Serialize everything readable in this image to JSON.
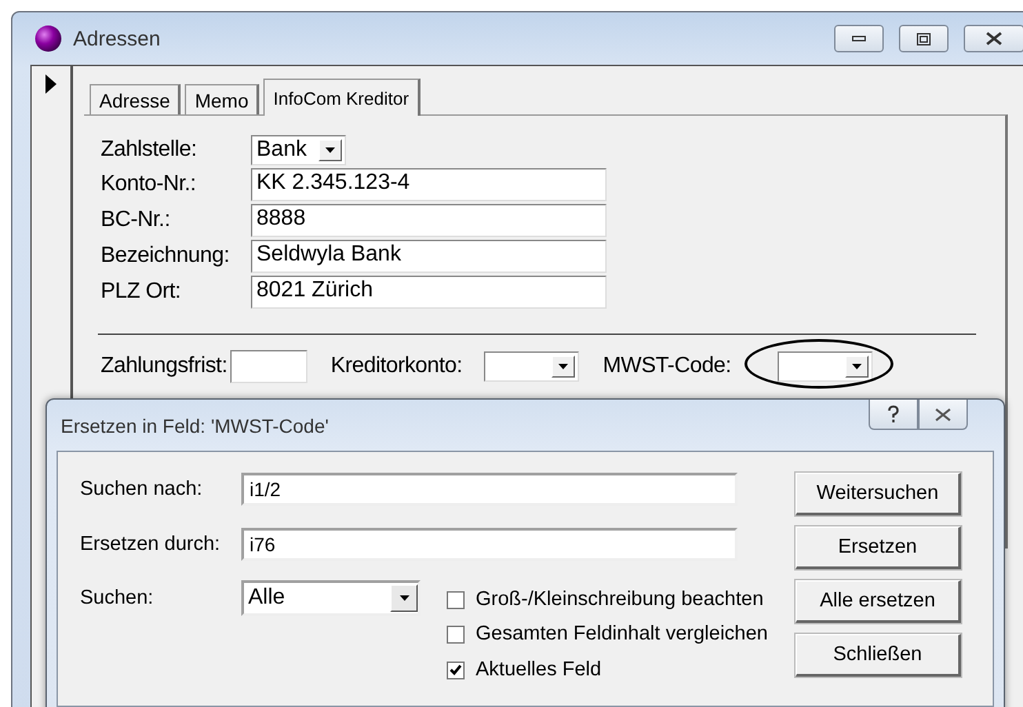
{
  "window": {
    "title": "Adressen"
  },
  "tabs": [
    {
      "label": "Adresse",
      "selected": false
    },
    {
      "label": "Memo",
      "selected": false
    },
    {
      "label": "InfoCom Kreditor",
      "selected": true
    }
  ],
  "bank_fields": [
    {
      "label": "Zahlstelle:",
      "value": "Bank",
      "kind": "combo"
    },
    {
      "label": "Konto-Nr.:",
      "value": "KK 2.345.123-4",
      "kind": "text"
    },
    {
      "label": "BC-Nr.:",
      "value": "8888",
      "kind": "text"
    },
    {
      "label": "Bezeichnung:",
      "value": "Seldwyla Bank",
      "kind": "text"
    },
    {
      "label": "PLZ Ort:",
      "value": "8021 Zürich",
      "kind": "text"
    }
  ],
  "bottom_fields": [
    {
      "label": "Zahlungsfrist:",
      "kind": "text",
      "highlighted": false
    },
    {
      "label": "Kreditorkonto:",
      "kind": "combo",
      "highlighted": false
    },
    {
      "label": "MWST-Code:",
      "kind": "combo",
      "highlighted": true
    }
  ],
  "dialog": {
    "title": "Ersetzen in Feld: 'MWST-Code'",
    "fields": [
      {
        "label": "Suchen nach:",
        "value": "i1/2",
        "kind": "text"
      },
      {
        "label": "Ersetzen durch:",
        "value": "i76",
        "kind": "text"
      },
      {
        "label": "Suchen:",
        "value": "Alle",
        "kind": "combo"
      }
    ],
    "options": [
      {
        "label": "Groß-/Kleinschreibung beachten",
        "checked": false
      },
      {
        "label": "Gesamten Feldinhalt vergleichen",
        "checked": false
      },
      {
        "label": "Aktuelles Feld",
        "checked": true
      }
    ],
    "buttons": [
      "Weitersuchen",
      "Ersetzen",
      "Alle ersetzen",
      "Schließen"
    ]
  }
}
